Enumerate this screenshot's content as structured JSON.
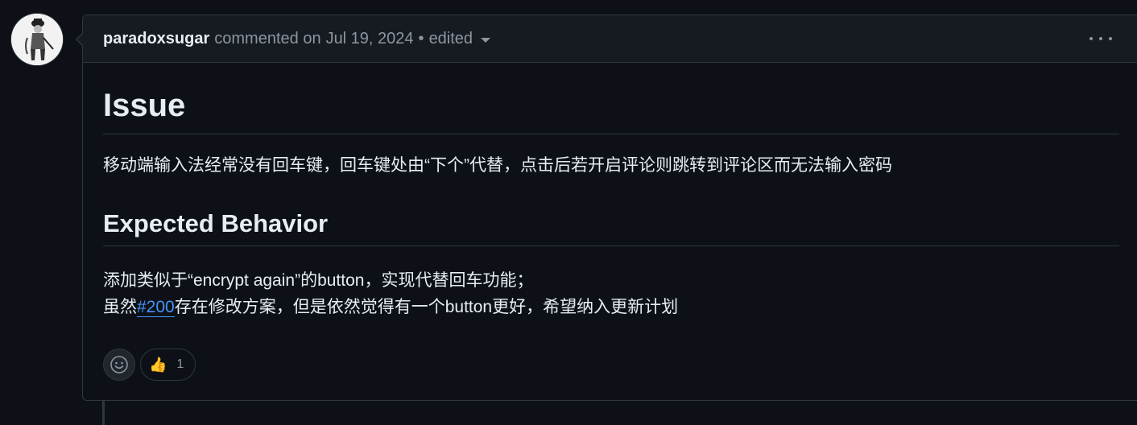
{
  "comment": {
    "author": "paradoxsugar",
    "action": "commented on",
    "date": "Jul 19, 2024",
    "separator": "•",
    "edited": "edited"
  },
  "body": {
    "h1": "Issue",
    "p1": "移动端输入法经常没有回车键，回车键处由“下个”代替，点击后若开启评论则跳转到评论区而无法输入密码",
    "h2": "Expected Behavior",
    "line1": "添加类似于“encrypt again”的button，实现代替回车功能；",
    "line2_before": "虽然",
    "line2_link": "#200",
    "line2_after": "存在修改方案，但是依然觉得有一个button更好，希望纳入更新计划"
  },
  "reactions": {
    "thumbs_up_emoji": "👍",
    "thumbs_up_count": "1"
  },
  "colors": {
    "background": "#0d1117",
    "header_bg": "#161b22",
    "border": "#30363d",
    "text": "#e6edf3",
    "muted": "#8d96a0",
    "link": "#4493f8"
  }
}
